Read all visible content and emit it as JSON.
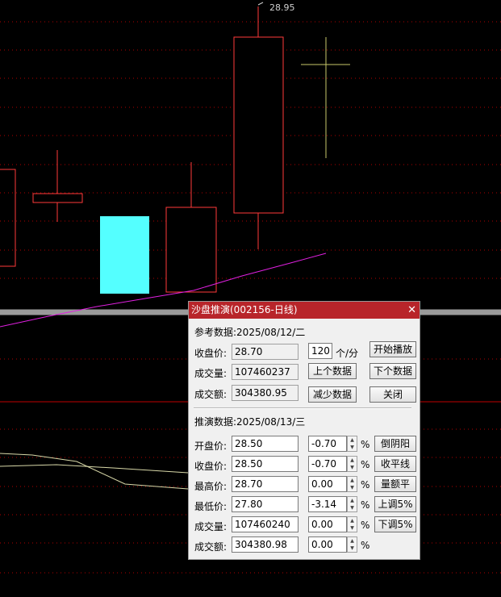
{
  "chart": {
    "peak_label": "28.95",
    "colors": {
      "up": "#ff3a3a",
      "down": "#54ffff",
      "doji": "#c8c86a",
      "ma": "#e020e0",
      "grid": "#b00000",
      "lower_line": "#d8d8a8",
      "separator": "#9a9a9a"
    }
  },
  "dialog": {
    "title": "沙盘推演(002156-日线)",
    "close_icon": "close-icon",
    "ref": {
      "header": "参考数据:2025/08/12/二",
      "close_label": "收盘价:",
      "close_value": "28.70",
      "volume_label": "成交量:",
      "volume_value": "107460237",
      "amount_label": "成交额:",
      "amount_value": "304380.95",
      "speed_value": "120",
      "speed_unit": "个/分",
      "play_button": "开始播放",
      "prev_button": "上个数据",
      "next_button": "下个数据",
      "reduce_button": "减少数据",
      "close_button": "关闭"
    },
    "sim": {
      "header": "推演数据:2025/08/13/三",
      "rows": [
        {
          "label": "开盘价:",
          "value": "28.50",
          "pct": "-0.70",
          "unit": "%",
          "button": "倒阴阳"
        },
        {
          "label": "收盘价:",
          "value": "28.50",
          "pct": "-0.70",
          "unit": "%",
          "button": "收平线"
        },
        {
          "label": "最高价:",
          "value": "28.70",
          "pct": "0.00",
          "unit": "%",
          "button": "量额平"
        },
        {
          "label": "最低价:",
          "value": "27.80",
          "pct": "-3.14",
          "unit": "%",
          "button": "上调5%"
        },
        {
          "label": "成交量:",
          "value": "107460240",
          "pct": "0.00",
          "unit": "%",
          "button": "下调5%"
        },
        {
          "label": "成交额:",
          "value": "304380.98",
          "pct": "0.00",
          "unit": "%"
        }
      ]
    }
  }
}
